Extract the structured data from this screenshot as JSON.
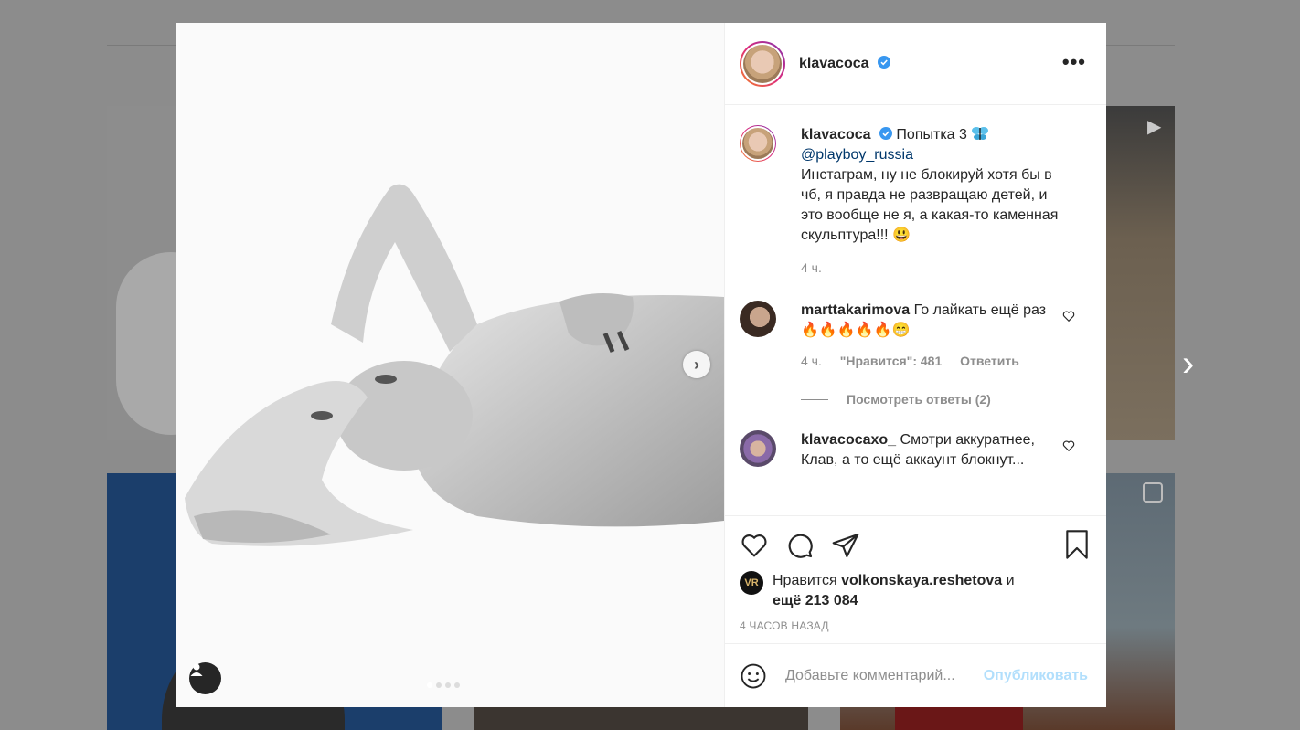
{
  "header": {
    "username": "klavacoca",
    "more_icon": "more-horizontal-icon"
  },
  "caption": {
    "username": "klavacoca",
    "title": "Попытка 3",
    "mention": "@playboy_russia",
    "text": "Инстаграм, ну не блокируй хотя бы в чб, я правда не развращаю детей, и это вообще не я, а какая-то каменная скульптура!!! 😃",
    "time": "4 ч."
  },
  "comments": [
    {
      "username": "marttakarimova",
      "text": "Го лайкать ещё раз 🔥🔥🔥🔥🔥😁",
      "time": "4 ч.",
      "likes": "\"Нравится\": 481",
      "reply": "Ответить",
      "view_replies": "Посмотреть ответы (2)"
    },
    {
      "username": "klavacocaxo_",
      "text": "Смотри аккуратнее, Клав, а то ещё аккаунт блокнут..."
    }
  ],
  "likes": {
    "prefix": "Нравится",
    "user": "volkonskaya.reshetova",
    "middle": "и",
    "rest": "ещё 213 084"
  },
  "timestamp": "4 ЧАСОВ НАЗАД",
  "add_comment": {
    "placeholder": "Добавьте комментарий...",
    "post_label": "Опубликовать"
  },
  "colors": {
    "verified": "#3897f0",
    "link": "#00376b",
    "post_disabled": "#b2dffc"
  }
}
